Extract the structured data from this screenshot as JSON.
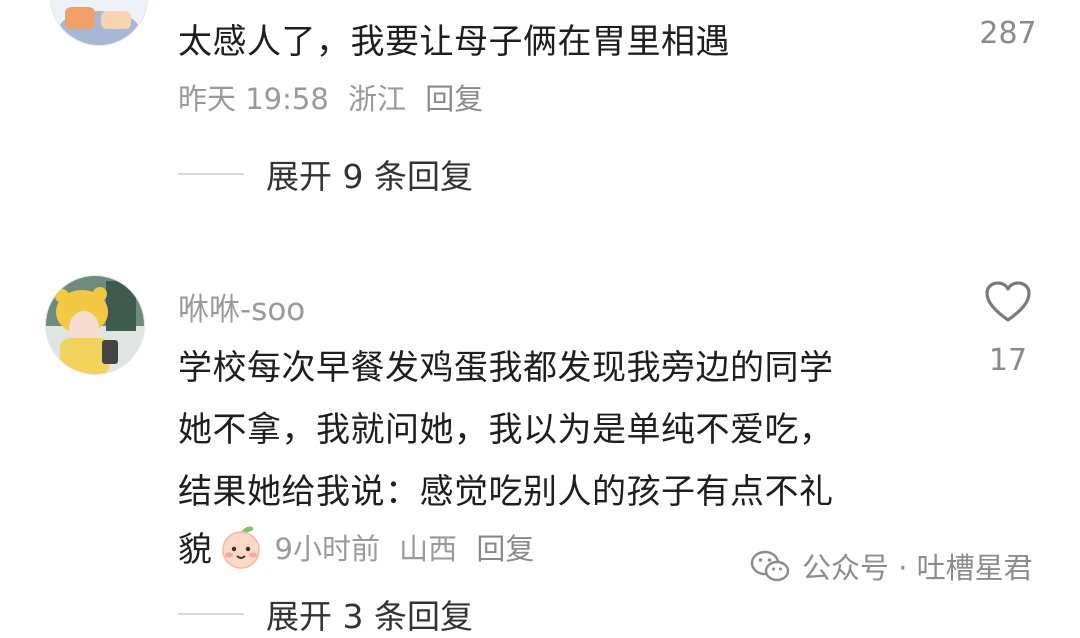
{
  "comment1": {
    "text": "太感人了，我要让母子俩在胃里相遇",
    "time": "昨天 19:58",
    "location": "浙江",
    "reply_label": "回复",
    "like_count": "287",
    "expand_label": "展开 9 条回复"
  },
  "comment2": {
    "username": "咻咻-soo",
    "text_lines": [
      "学校每次早餐发鸡蛋我都发现我旁边的同学",
      "她不拿，我就问她，我以为是单纯不爱吃，",
      "结果她给我说：感觉吃别人的孩子有点不礼",
      "貌"
    ],
    "time": "9小时前",
    "location": "山西",
    "reply_label": "回复",
    "like_count": "17",
    "expand_label": "展开 3 条回复"
  },
  "watermark": {
    "text": "公众号 · 吐槽星君"
  },
  "icons": {
    "like": "heart-outline-icon",
    "emoji": "peach-face-emoji-icon",
    "wechat": "wechat-icon"
  }
}
